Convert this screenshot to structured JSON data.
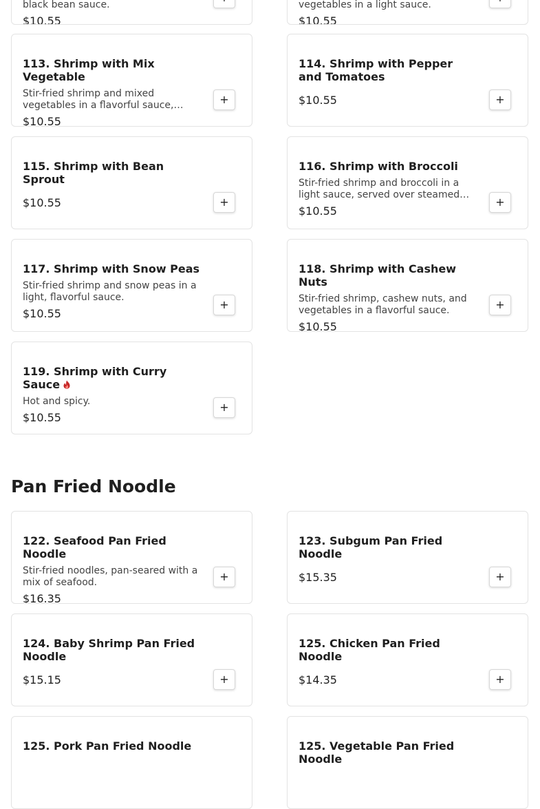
{
  "top_partial": [
    {
      "desc": "black bean sauce.",
      "price": "$10.55"
    },
    {
      "desc": "vegetables in a light sauce.",
      "price": "$10.55"
    }
  ],
  "shrimp_items": [
    {
      "name": "113. Shrimp with Mix Vegetable",
      "desc": "Stir-fried shrimp and mixed vegetables in a flavorful sauce, served with steamed rice.",
      "price": "$10.55"
    },
    {
      "name": "114. Shrimp with Pepper and Tomatoes",
      "desc": "",
      "price": "$10.55"
    },
    {
      "name": "115. Shrimp with Bean Sprout",
      "desc": "",
      "price": "$10.55"
    },
    {
      "name": "116. Shrimp with Broccoli",
      "desc": "Stir-fried shrimp and broccoli in a light sauce, served over steamed rice.",
      "price": "$10.55"
    },
    {
      "name": "117. Shrimp with Snow Peas",
      "desc": "Stir-fried shrimp and snow peas in a light, flavorful sauce.",
      "price": "$10.55"
    },
    {
      "name": "118. Shrimp with Cashew Nuts",
      "desc": "Stir-fried shrimp, cashew nuts, and vegetables in a flavorful sauce.",
      "price": "$10.55"
    },
    {
      "name": "119. Shrimp with Curry Sauce",
      "desc": "Hot and spicy.",
      "price": "$10.55",
      "spicy_icon": "spicy-icon"
    }
  ],
  "noodle_section": {
    "title": "Pan Fried Noodle",
    "items": [
      {
        "name": "122. Seafood Pan Fried Noodle",
        "desc": "Stir-fried noodles, pan-seared with a mix of seafood.",
        "price": "$16.35"
      },
      {
        "name": "123. Subgum Pan Fried Noodle",
        "desc": "",
        "price": "$15.35"
      },
      {
        "name": "124. Baby Shrimp Pan Fried Noodle",
        "desc": "",
        "price": "$15.15"
      },
      {
        "name": "125. Chicken Pan Fried Noodle",
        "desc": "",
        "price": "$14.35"
      },
      {
        "name": "125. Pork Pan Fried Noodle",
        "desc": "",
        "price": ""
      },
      {
        "name": "125. Vegetable Pan Fried Noodle",
        "desc": "",
        "price": ""
      }
    ]
  },
  "add_button_label": "+",
  "colors": {
    "border": "#e3e3e3",
    "text": "#1f1f1f",
    "muted": "#444444",
    "spicy": "#c62828"
  }
}
